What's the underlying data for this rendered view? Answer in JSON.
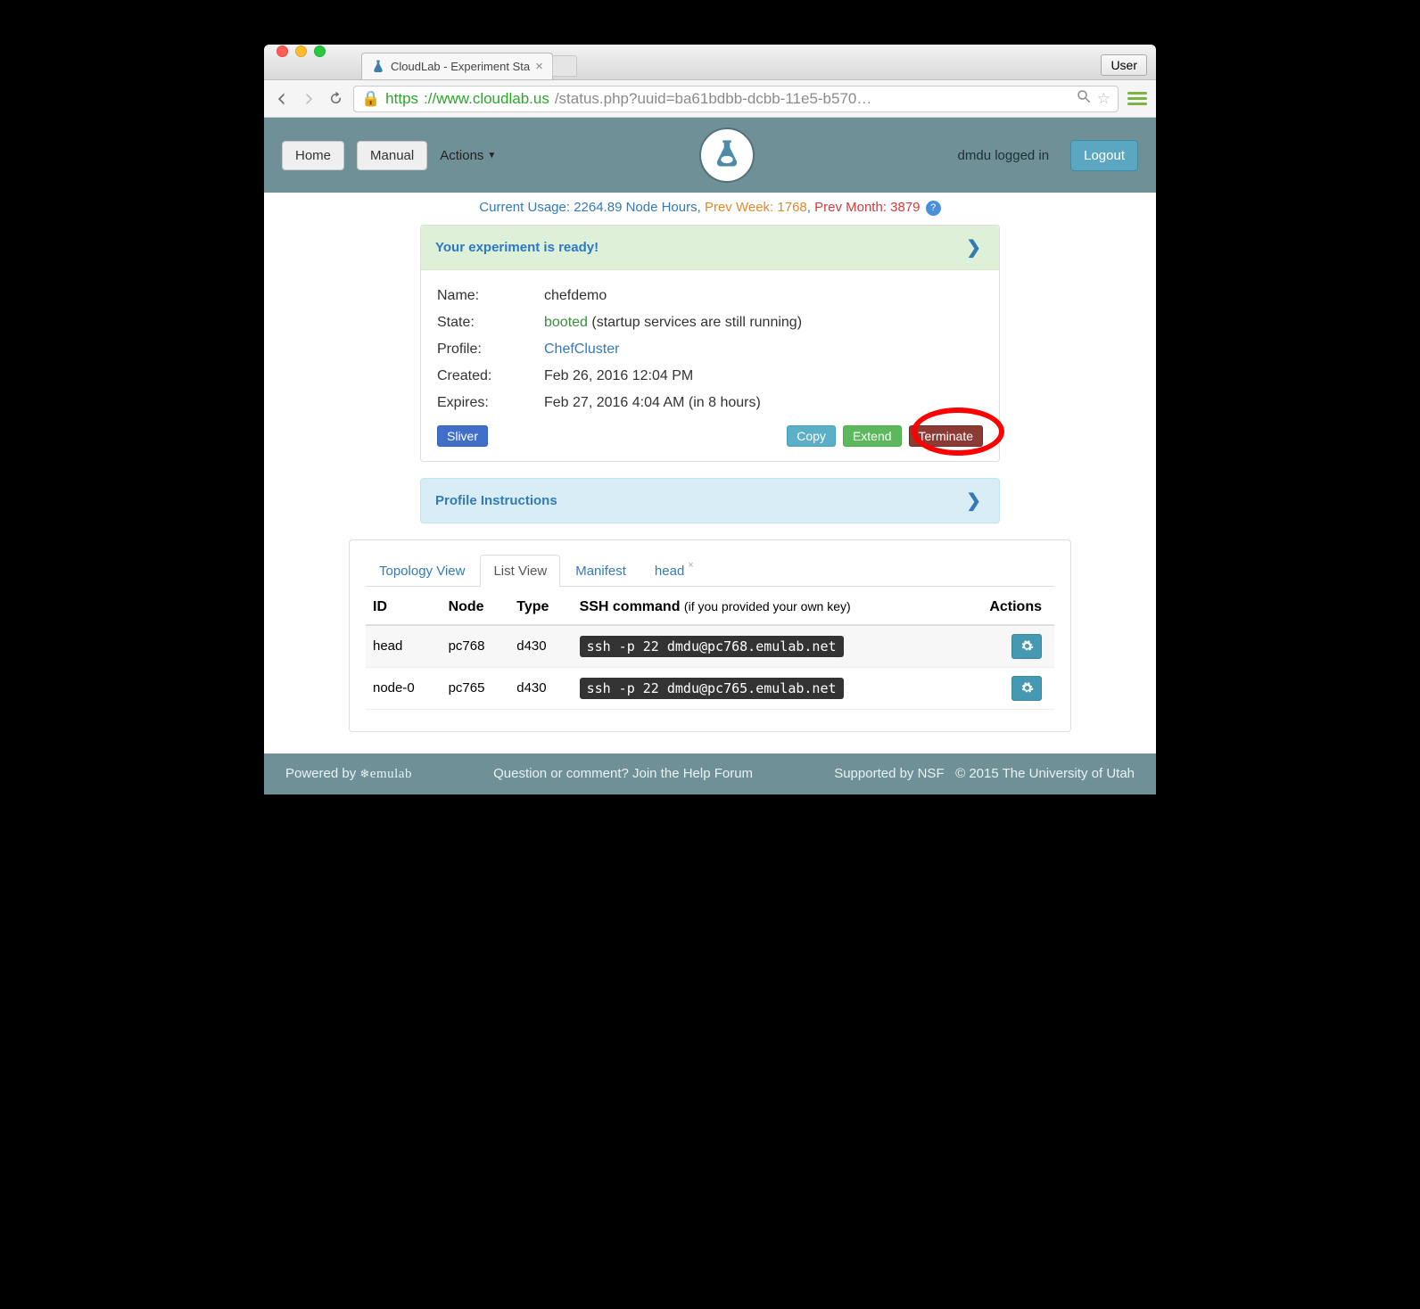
{
  "browser": {
    "tab_title": "CloudLab - Experiment Sta",
    "user_button": "User",
    "url_scheme": "https",
    "url_host": "://www.cloudlab.us",
    "url_path": "/status.php?uuid=ba61bdbb-dcbb-11e5-b570…"
  },
  "header": {
    "home": "Home",
    "manual": "Manual",
    "actions": "Actions",
    "login_text": "dmdu logged in",
    "logout": "Logout"
  },
  "usage": {
    "current_label": "Current Usage: ",
    "current_value": "2264.89 Node Hours",
    "prev_week_label": "Prev Week: ",
    "prev_week_value": "1768",
    "prev_month_label": "Prev Month: ",
    "prev_month_value": "3879"
  },
  "status_panel": {
    "title": "Your experiment is ready!",
    "name_label": "Name:",
    "name_value": "chefdemo",
    "state_label": "State:",
    "state_value": "booted",
    "state_extra": " (startup services are still running)",
    "profile_label": "Profile:",
    "profile_value": "ChefCluster",
    "created_label": "Created:",
    "created_value": "Feb 26, 2016 12:04 PM",
    "expires_label": "Expires:",
    "expires_value": "Feb 27, 2016 4:04 AM (in 8 hours)",
    "sliver_btn": "Sliver",
    "copy_btn": "Copy",
    "extend_btn": "Extend",
    "terminate_btn": "Terminate"
  },
  "instructions_panel": {
    "title": "Profile Instructions"
  },
  "tabs": {
    "topology": "Topology View",
    "list": "List View",
    "manifest": "Manifest",
    "head": "head"
  },
  "table": {
    "cols": {
      "id": "ID",
      "node": "Node",
      "type": "Type",
      "ssh": "SSH command ",
      "ssh_sub": "(if you provided your own key)",
      "actions": "Actions"
    },
    "rows": [
      {
        "id": "head",
        "node": "pc768",
        "type": "d430",
        "ssh": "ssh -p 22 dmdu@pc768.emulab.net"
      },
      {
        "id": "node-0",
        "node": "pc765",
        "type": "d430",
        "ssh": "ssh -p 22 dmdu@pc765.emulab.net"
      }
    ]
  },
  "footer": {
    "powered": "Powered by ",
    "emulab": "emulab",
    "question": "Question or comment? Join the Help Forum",
    "supported": "Supported by NSF",
    "copyright": "© 2015 The University of Utah"
  }
}
